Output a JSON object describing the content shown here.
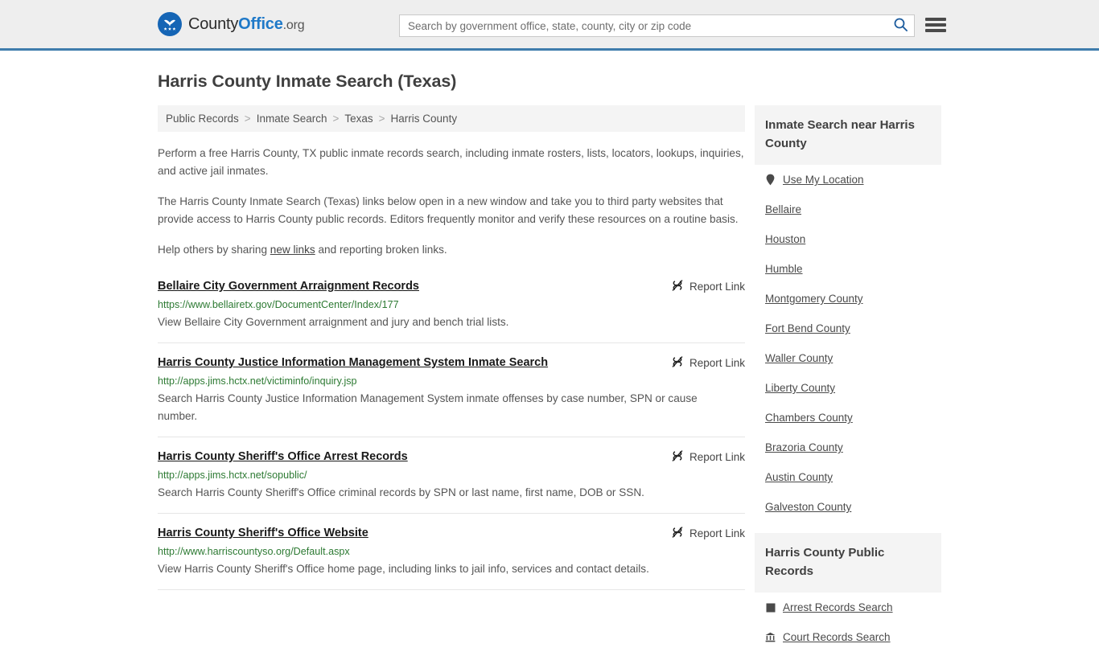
{
  "header": {
    "brand": {
      "county": "County",
      "office": "Office",
      "org": ".org",
      "seal_icon": "eagle-stars-seal-icon"
    },
    "search": {
      "placeholder": "Search by government office, state, county, city or zip code",
      "value": "",
      "search_icon": "search-icon"
    },
    "menu_icon": "hamburger-menu-icon",
    "accent_color": "#3f7cac"
  },
  "page": {
    "title": "Harris County Inmate Search (Texas)"
  },
  "breadcrumb": {
    "separator": ">",
    "items": [
      {
        "label": "Public Records"
      },
      {
        "label": "Inmate Search"
      },
      {
        "label": "Texas"
      },
      {
        "label": "Harris County"
      }
    ]
  },
  "intro": {
    "p1": "Perform a free Harris County, TX public inmate records search, including inmate rosters, lists, locators, lookups, inquiries, and active jail inmates.",
    "p2": "The Harris County Inmate Search (Texas) links below open in a new window and take you to third party websites that provide access to Harris County public records. Editors frequently monitor and verify these resources on a routine basis.",
    "p3_before": "Help others by sharing ",
    "p3_link": "new links",
    "p3_after": " and reporting broken links."
  },
  "results": {
    "report_label": "Report Link",
    "report_icon": "broken-link-icon",
    "items": [
      {
        "title": "Bellaire City Government Arraignment Records",
        "url": "https://www.bellairetx.gov/DocumentCenter/Index/177",
        "description": "View Bellaire City Government arraignment and jury and bench trial lists."
      },
      {
        "title": "Harris County Justice Information Management System Inmate Search",
        "url": "http://apps.jims.hctx.net/victiminfo/inquiry.jsp",
        "description": "Search Harris County Justice Information Management System inmate offenses by case number, SPN or cause number."
      },
      {
        "title": "Harris County Sheriff's Office Arrest Records",
        "url": "http://apps.jims.hctx.net/sopublic/",
        "description": "Search Harris County Sheriff's Office criminal records by SPN or last name, first name, DOB or SSN."
      },
      {
        "title": "Harris County Sheriff's Office Website",
        "url": "http://www.harriscountyso.org/Default.aspx",
        "description": "View Harris County Sheriff's Office home page, including links to jail info, services and contact details."
      }
    ]
  },
  "sidebar": {
    "nearby": {
      "heading": "Inmate Search near Harris County",
      "use_my_location": {
        "label": "Use My Location",
        "icon": "map-pin-icon"
      },
      "places": [
        {
          "label": "Bellaire"
        },
        {
          "label": "Houston"
        },
        {
          "label": "Humble"
        },
        {
          "label": "Montgomery County"
        },
        {
          "label": "Fort Bend County"
        },
        {
          "label": "Waller County"
        },
        {
          "label": "Liberty County"
        },
        {
          "label": "Chambers County"
        },
        {
          "label": "Brazoria County"
        },
        {
          "label": "Austin County"
        },
        {
          "label": "Galveston County"
        }
      ]
    },
    "public_records": {
      "heading": "Harris County Public Records",
      "items": [
        {
          "label": "Arrest Records Search",
          "icon": "fingerprint-square-icon"
        },
        {
          "label": "Court Records Search",
          "icon": "courthouse-icon"
        }
      ]
    }
  }
}
